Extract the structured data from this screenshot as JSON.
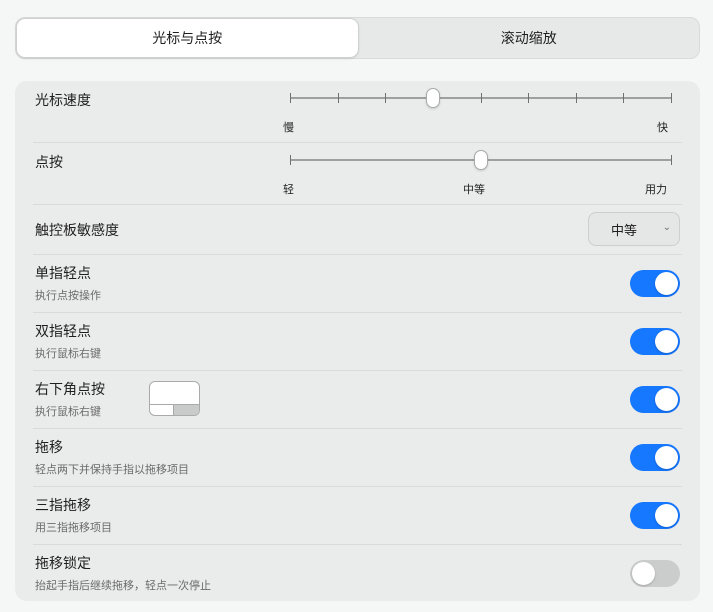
{
  "tabs": [
    {
      "label": "光标与点按",
      "active": true
    },
    {
      "label": "滚动缩放",
      "active": false
    }
  ],
  "pointer_speed": {
    "label": "光标速度",
    "min_label": "慢",
    "max_label": "快",
    "ticks": 9,
    "value_fraction": 0.375
  },
  "click": {
    "label": "点按",
    "min_label": "轻",
    "mid_label": "中等",
    "max_label": "用力",
    "value_fraction": 0.5
  },
  "touchpad_sensitivity": {
    "label": "触控板敏感度",
    "selected": "中等"
  },
  "toggles": [
    {
      "label": "单指轻点",
      "desc": "执行点按操作",
      "on": true
    },
    {
      "label": "双指轻点",
      "desc": "执行鼠标右键",
      "on": true
    },
    {
      "label": "右下角点按",
      "desc": "执行鼠标右键",
      "on": true
    },
    {
      "label": "拖移",
      "desc": "轻点两下并保持手指以拖移项目",
      "on": true
    },
    {
      "label": "三指拖移",
      "desc": "用三指拖移项目",
      "on": true
    },
    {
      "label": "拖移锁定",
      "desc": "抬起手指后继续拖移，轻点一次停止",
      "on": false
    }
  ],
  "colors": {
    "accent": "#1677ff",
    "toggle_off": "#cbcccc"
  }
}
